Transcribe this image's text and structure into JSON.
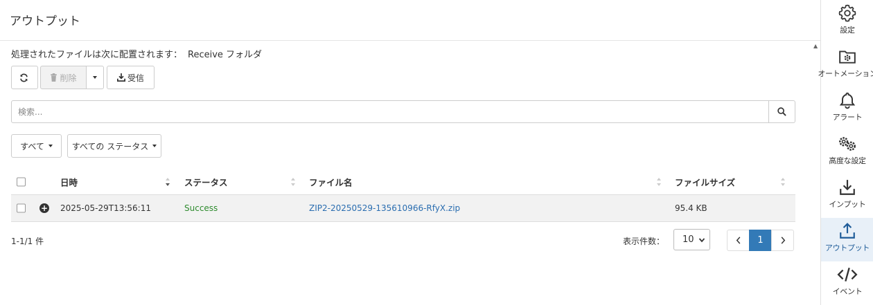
{
  "header": {
    "title": "アウトプット"
  },
  "info": {
    "text": "処理されたファイルは次に配置されます：",
    "folder": "Receive フォルダ"
  },
  "toolbar": {
    "delete_label": "削除",
    "receive_label": "受信"
  },
  "search": {
    "placeholder": "検索..."
  },
  "filters": {
    "type_label": "すべて",
    "status_label": "すべての ステータス"
  },
  "table": {
    "columns": [
      "日時",
      "ステータス",
      "ファイル名",
      "ファイルサイズ"
    ],
    "rows": [
      {
        "datetime": "2025-05-29T13:56:11",
        "status": "Success",
        "filename": "ZIP2-20250529-135610966-RfyX.zip",
        "size": "95.4 KB"
      }
    ]
  },
  "footer": {
    "count": "1-1/1 件",
    "page_size_label": "表示件数：",
    "page_size": "10",
    "current_page": "1"
  },
  "sidebar": {
    "items": [
      {
        "label": "設定",
        "icon": "gear-icon"
      },
      {
        "label": "オートメーション",
        "icon": "folder-gear-icon"
      },
      {
        "label": "アラート",
        "icon": "bell-icon"
      },
      {
        "label": "高度な設定",
        "icon": "gears-icon"
      },
      {
        "label": "インプット",
        "icon": "download-icon"
      },
      {
        "label": "アウトプット",
        "icon": "upload-icon"
      },
      {
        "label": "イベント",
        "icon": "code-icon"
      }
    ],
    "active": "アウトプット"
  },
  "colors": {
    "accent": "#337ab7",
    "success": "#2e8b2e",
    "link": "#2a6db0"
  }
}
